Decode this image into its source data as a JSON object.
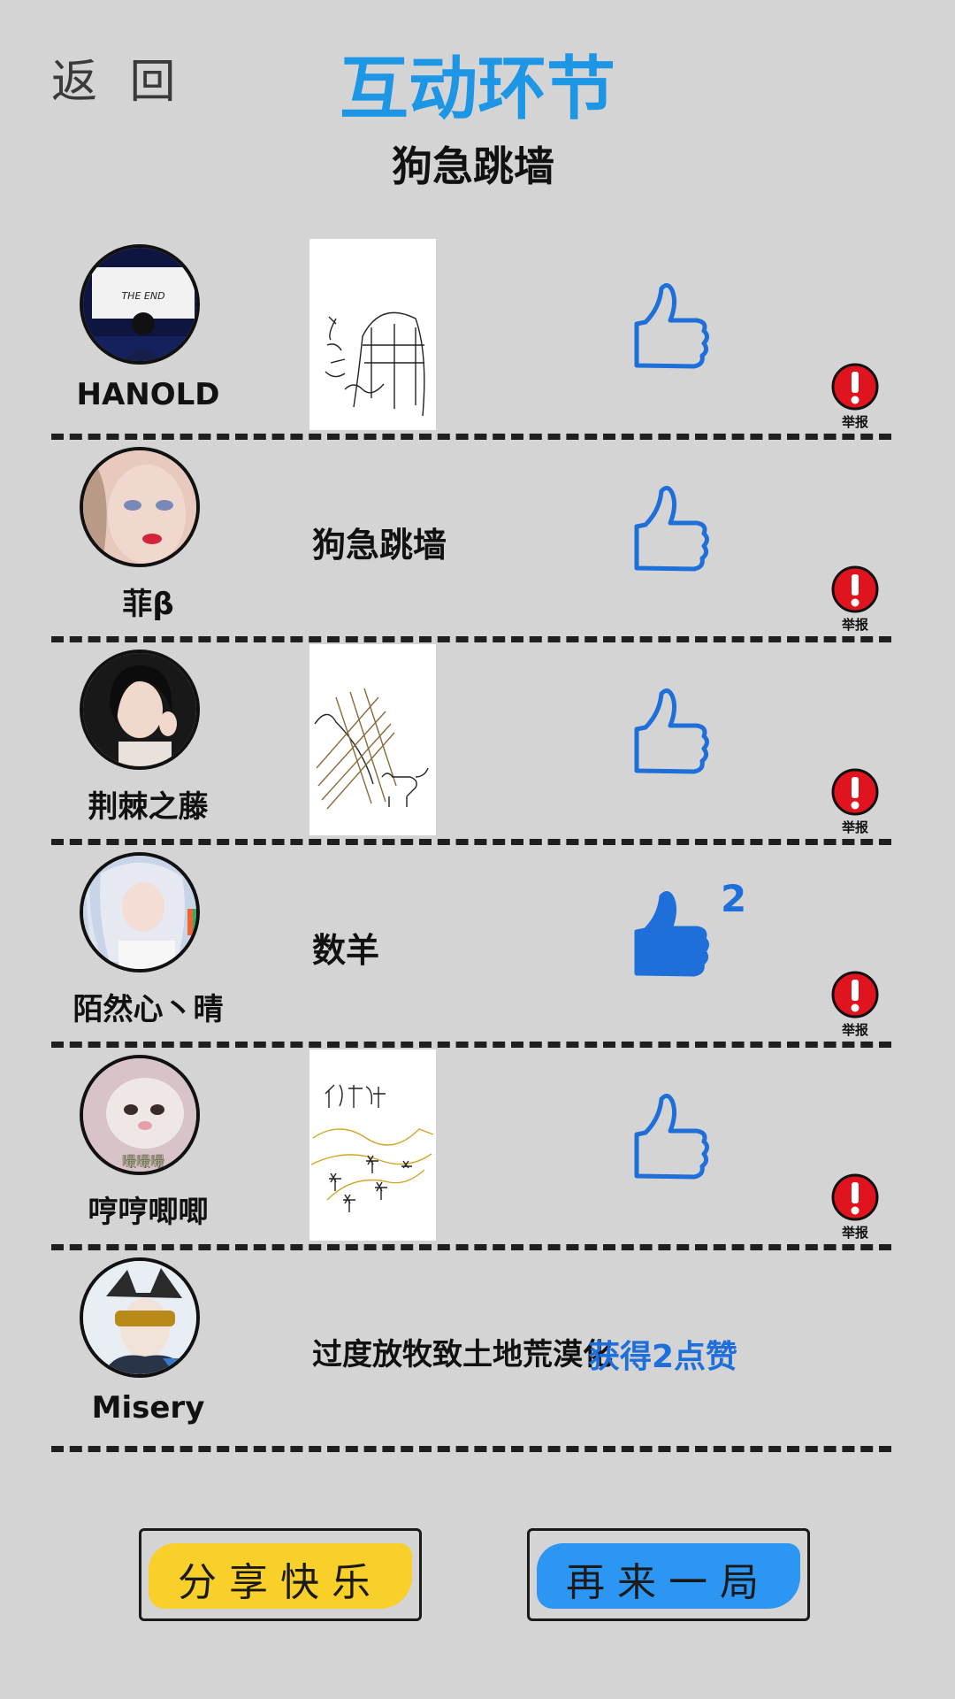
{
  "header": {
    "back_label": "返 回",
    "title": "互动环节",
    "topic": "狗急跳墙"
  },
  "colors": {
    "accent": "#1e96e6",
    "like": "#1e6fd9",
    "report": "#e0141e",
    "share_btn": "#f9cf2a",
    "again_btn": "#2c96f3",
    "bg": "#d4d4d4"
  },
  "rows": [
    {
      "user": "HANOLD",
      "answer_type": "drawing",
      "liked": false,
      "report_label": "举报"
    },
    {
      "user": "菲β",
      "answer_type": "text",
      "answer": "狗急跳墙",
      "liked": false,
      "report_label": "举报"
    },
    {
      "user": "荆棘之藤",
      "answer_type": "drawing",
      "liked": false,
      "report_label": "举报"
    },
    {
      "user": "陌然心丶晴",
      "answer_type": "text",
      "answer": "数羊",
      "liked": true,
      "likes": "2",
      "report_label": "举报"
    },
    {
      "user": "哼哼唧唧",
      "answer_type": "drawing",
      "liked": false,
      "report_label": "举报"
    },
    {
      "user": "Misery",
      "answer_type": "text",
      "answer": "过度放牧致土地荒漠化"
    }
  ],
  "result_text": "获得2点赞",
  "buttons": {
    "share": "分享快乐",
    "again": "再来一局"
  }
}
